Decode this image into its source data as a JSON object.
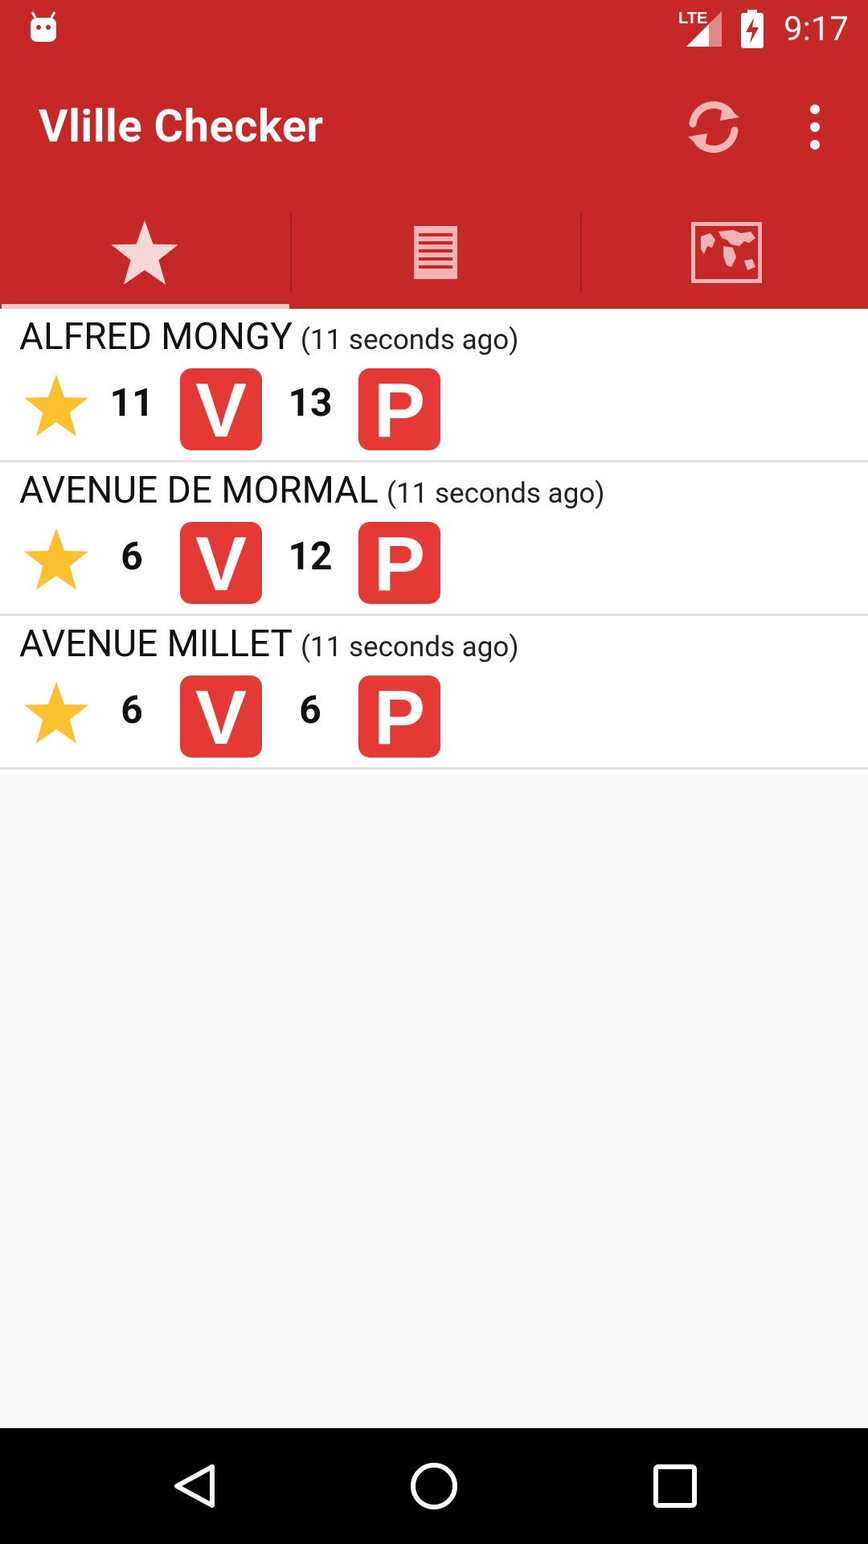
{
  "status_bar": {
    "time": "9:17",
    "network": "LTE"
  },
  "app_bar": {
    "title": "Vlille Checker"
  },
  "tabs": [
    {
      "name": "favorites",
      "icon": "star-icon"
    },
    {
      "name": "stations",
      "icon": "list-icon"
    },
    {
      "name": "map",
      "icon": "map-icon"
    }
  ],
  "stations": [
    {
      "name": "ALFRED MONGY",
      "updated": "(11 seconds ago)",
      "bikes": "11",
      "bike_badge": "V",
      "slots": "13",
      "slot_badge": "P"
    },
    {
      "name": "AVENUE DE MORMAL",
      "updated": "(11 seconds ago)",
      "bikes": "6",
      "bike_badge": "V",
      "slots": "12",
      "slot_badge": "P"
    },
    {
      "name": "AVENUE MILLET",
      "updated": "(11 seconds ago)",
      "bikes": "6",
      "bike_badge": "V",
      "slots": "6",
      "slot_badge": "P"
    }
  ],
  "colors": {
    "primary": "#c62828",
    "badge": "#e53935",
    "star": "#fbc02d"
  }
}
